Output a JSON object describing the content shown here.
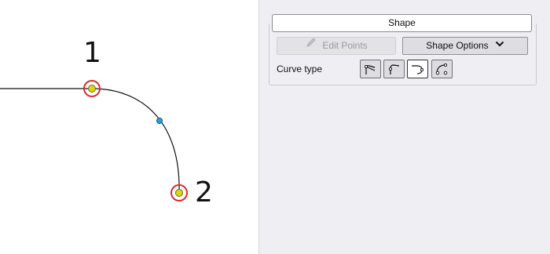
{
  "canvas": {
    "point_labels": [
      "1",
      "2"
    ]
  },
  "panel": {
    "header_title": "Shape",
    "edit_points_label": "Edit Points",
    "shape_options_label": "Shape Options",
    "curve_type_label": "Curve type",
    "curve_tools": [
      {
        "icon": "corner-curve-icon",
        "active": false
      },
      {
        "icon": "smooth-corner-curve-icon",
        "active": false
      },
      {
        "icon": "tangent-curve-icon",
        "active": true
      },
      {
        "icon": "spline-curve-icon",
        "active": false
      }
    ]
  },
  "colors": {
    "marker_ring": "#e0262c",
    "marker_fill": "#d8d81a",
    "midpoint_fill": "#2a9fe0",
    "panel_bg": "#efeff3"
  }
}
